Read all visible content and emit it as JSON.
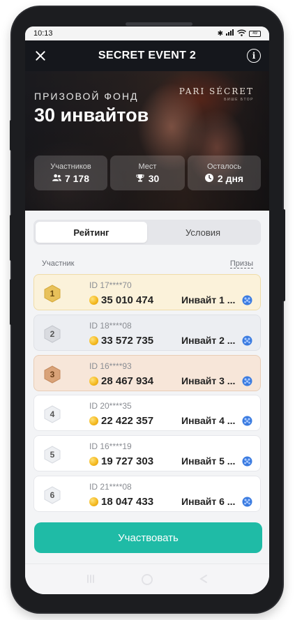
{
  "status_bar": {
    "time": "10:13",
    "battery": "49"
  },
  "header": {
    "title": "SECRET EVENT 2",
    "close_icon": "close-icon",
    "info_icon": "info-icon"
  },
  "hero": {
    "brand": "PARI SÉCRET",
    "brand_sub": "БИШЕ БТОР",
    "prize_label": "ПРИЗОВОЙ ФОНД",
    "prize_value": "30 инвайтов",
    "stats": [
      {
        "label": "Участников",
        "value": "7 178",
        "icon": "people-icon"
      },
      {
        "label": "Мест",
        "value": "30",
        "icon": "trophy-icon"
      },
      {
        "label": "Осталось",
        "value": "2 дня",
        "icon": "clock-icon"
      }
    ]
  },
  "tabs": [
    {
      "label": "Рейтинг",
      "active": true
    },
    {
      "label": "Условия",
      "active": false
    }
  ],
  "list_header": {
    "participant": "Участник",
    "prizes": "Призы"
  },
  "rows": [
    {
      "rank": "1",
      "id": "ID 17****70",
      "score": "35 010 474",
      "prize": "Инвайт 1 ..."
    },
    {
      "rank": "2",
      "id": "ID 18****08",
      "score": "33 572 735",
      "prize": "Инвайт 2 ..."
    },
    {
      "rank": "3",
      "id": "ID 16****93",
      "score": "28 467 934",
      "prize": "Инвайт 3 ..."
    },
    {
      "rank": "4",
      "id": "ID 20****35",
      "score": "22 422 357",
      "prize": "Инвайт 4 ..."
    },
    {
      "rank": "5",
      "id": "ID 16****19",
      "score": "19 727 303",
      "prize": "Инвайт 5 ..."
    },
    {
      "rank": "6",
      "id": "ID 21****08",
      "score": "18 047 433",
      "prize": "Инвайт 6 ..."
    }
  ],
  "cta": {
    "label": "Участвовать"
  },
  "colors": {
    "accent": "#1fbba6",
    "gold": "#e8c15a",
    "silver": "#d9dbe0",
    "bronze": "#d9a278"
  }
}
